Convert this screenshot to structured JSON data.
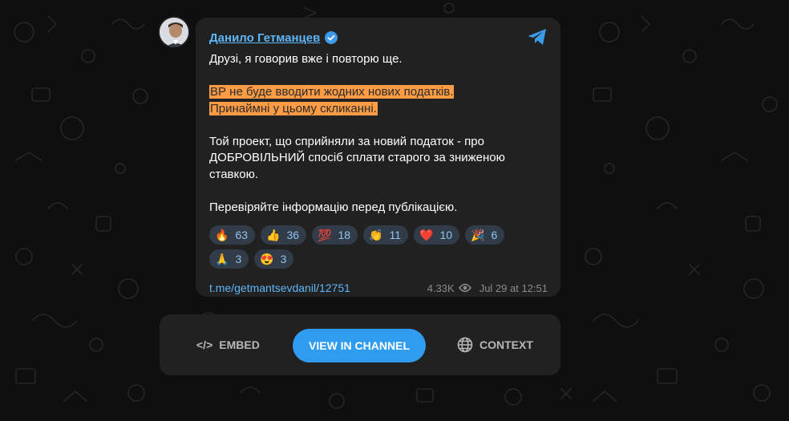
{
  "post": {
    "author": "Данило Гетманцев",
    "lines_intro": "Друзі, я говорив вже і повторю ще.",
    "highlight_1": "ВР не буде вводити жодних нових податків.",
    "highlight_2": "Принаймні у цьому скликанні.",
    "para2_line1": "Той проект, що сприйняли за новий податок - про",
    "para2_line2": "ДОБРОВІЛЬНИЙ спосіб сплати старого за зниженою",
    "para2_line3": "ставкою.",
    "closing": "Перевіряйте інформацію перед публікацією.",
    "reactions": [
      {
        "emoji": "🔥",
        "count": "63"
      },
      {
        "emoji": "👍",
        "count": "36"
      },
      {
        "emoji": "💯",
        "count": "18"
      },
      {
        "emoji": "👏",
        "count": "11"
      },
      {
        "emoji": "❤️",
        "count": "10"
      },
      {
        "emoji": "🎉",
        "count": "6"
      },
      {
        "emoji": "🙏",
        "count": "3"
      },
      {
        "emoji": "😍",
        "count": "3"
      }
    ],
    "link": "t.me/getmantsevdanil/12751",
    "views": "4.33K",
    "date": "Jul 29 at 12:51"
  },
  "actions": {
    "embed_label": "EMBED",
    "embed_icon": "</>",
    "view_label": "VIEW IN CHANNEL",
    "context_label": "CONTEXT"
  },
  "colors": {
    "accent": "#2f9cf0",
    "link": "#5eb5f7",
    "highlight": "#fe9b45",
    "card": "#212121",
    "background": "#0f0f0f"
  },
  "icons": [
    "telegram-icon",
    "verified-icon",
    "eye-icon",
    "embed-code-icon",
    "globe-icon"
  ]
}
